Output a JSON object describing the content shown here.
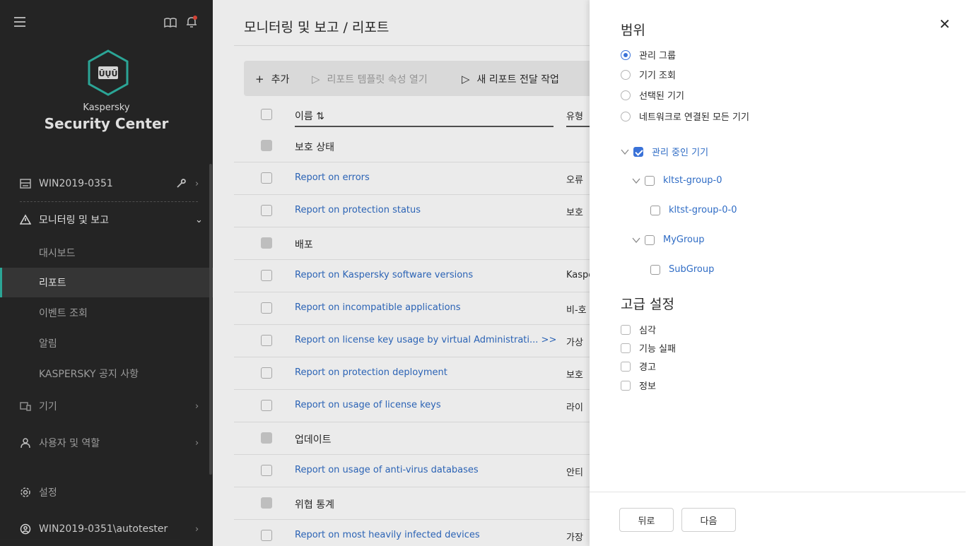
{
  "sidebar": {
    "brand_small": "Kaspersky",
    "brand_big": "Security Center",
    "server": "WIN2019-0351",
    "monitoring": "모니터링 및 보고",
    "items": [
      {
        "label": "대시보드"
      },
      {
        "label": "리포트"
      },
      {
        "label": "이벤트 조회"
      },
      {
        "label": "알림"
      },
      {
        "label": "KASPERSKY 공지 사항"
      }
    ],
    "devices": "기기",
    "users_roles": "사용자 및 역할",
    "settings": "설정",
    "account": "WIN2019-0351\\autotester"
  },
  "main": {
    "title": "모니터링 및 보고 / 리포트",
    "toolbar": {
      "add": "추가",
      "open_template": "리포트 템플릿 속성 열기",
      "new_delivery": "새 리포트 전달 작업"
    },
    "header": {
      "name": "이름 ⇅",
      "type": "유형"
    },
    "rows": [
      {
        "name": "보호 상태",
        "type": ""
      },
      {
        "name": "Report on errors",
        "type": "오류"
      },
      {
        "name": "Report on protection status",
        "type": "보호"
      },
      {
        "name": "배포",
        "type": ""
      },
      {
        "name": "Report on Kaspersky software versions",
        "type": "Kaspe"
      },
      {
        "name": "Report on incompatible applications",
        "type": "비-호"
      },
      {
        "name": "Report on license key usage by virtual Administrati... >>",
        "type": "가상"
      },
      {
        "name": "Report on protection deployment",
        "type": "보호"
      },
      {
        "name": "Report on usage of license keys",
        "type": "라이"
      },
      {
        "name": "업데이트",
        "type": ""
      },
      {
        "name": "Report on usage of anti-virus databases",
        "type": "안티"
      },
      {
        "name": "위협 통계",
        "type": ""
      },
      {
        "name": "Report on most heavily infected devices",
        "type": "가장"
      }
    ]
  },
  "panel": {
    "scope_title": "범위",
    "scope_options": [
      {
        "label": "관리 그룹",
        "selected": true
      },
      {
        "label": "기기 조회",
        "selected": false
      },
      {
        "label": "선택된 기기",
        "selected": false
      },
      {
        "label": "네트워크로 연결된 모든 기기",
        "selected": false
      }
    ],
    "tree": {
      "root": "관리 중인 기기",
      "g0": "kltst-group-0",
      "g00": "kltst-group-0-0",
      "my": "MyGroup",
      "sub": "SubGroup"
    },
    "advanced_title": "고급 설정",
    "severity": [
      {
        "label": "심각"
      },
      {
        "label": "기능 실패"
      },
      {
        "label": "경고"
      },
      {
        "label": "정보"
      }
    ],
    "back": "뒤로",
    "next": "다음"
  },
  "colors": {
    "accent": "#3a72d8",
    "sidebar_bg": "#282828",
    "active_marker": "#2fb3a3",
    "link": "#2f6cc5"
  }
}
